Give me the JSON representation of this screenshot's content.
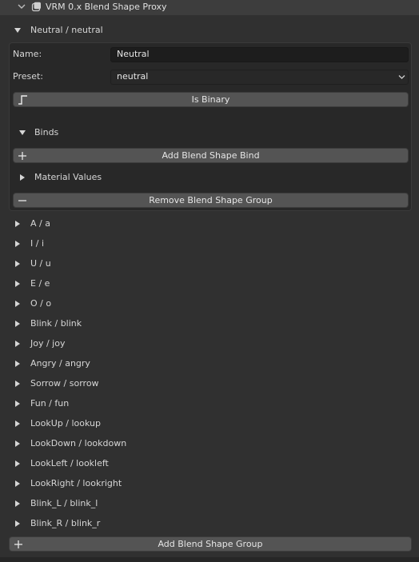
{
  "header": {
    "title": "VRM 0.x Blend Shape Proxy",
    "chevron_icon": "chevron-down-icon",
    "panel_icon": "cube-icon"
  },
  "group": {
    "title": "Neutral / neutral",
    "name_label": "Name:",
    "name_value": "Neutral",
    "preset_label": "Preset:",
    "preset_value": "neutral",
    "is_binary_label": "Is Binary",
    "binds_label": "Binds",
    "add_bind_label": "Add Blend Shape Bind",
    "material_values_label": "Material Values",
    "remove_group_label": "Remove Blend Shape Group"
  },
  "groups": [
    "A / a",
    "I / i",
    "U / u",
    "E / e",
    "O / o",
    "Blink / blink",
    "Joy / joy",
    "Angry / angry",
    "Sorrow / sorrow",
    "Fun / fun",
    "LookUp / lookup",
    "LookDown / lookdown",
    "LookLeft / lookleft",
    "LookRight / lookright",
    "Blink_L / blink_l",
    "Blink_R / blink_r"
  ],
  "add_group_label": "Add Blend Shape Group",
  "colors": {
    "background": "#303030",
    "header": "#3d3d3d",
    "button": "#545454",
    "field": "#1d1d1d"
  }
}
